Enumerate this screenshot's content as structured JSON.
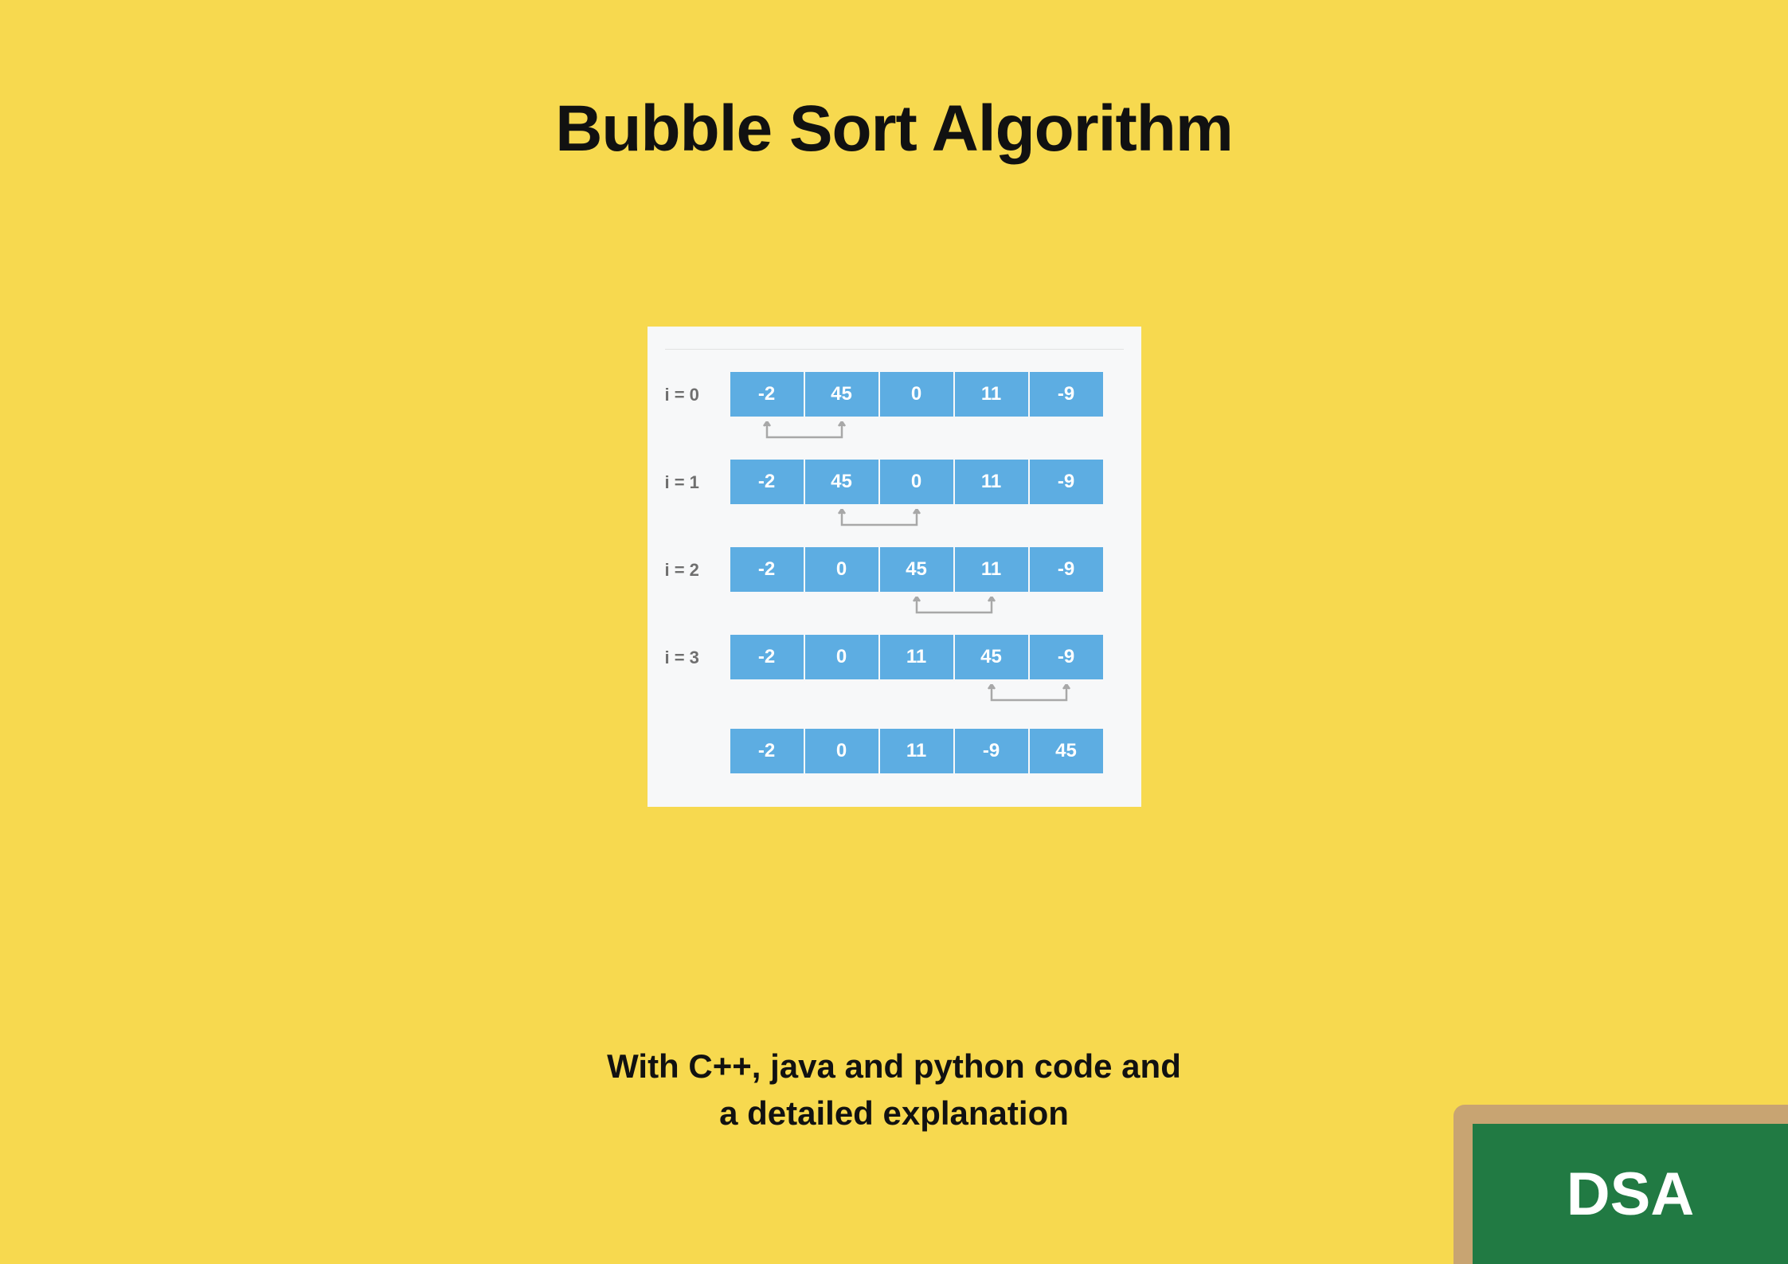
{
  "title": "Bubble Sort Algorithm",
  "subtitle_line1": "With C++, java and python  code and",
  "subtitle_line2": "a detailed explanation",
  "badge": "DSA",
  "colors": {
    "background": "#f7d94f",
    "cell": "#5dade2",
    "boardFrame": "#c8a472",
    "boardGreen": "#217a43"
  },
  "steps": [
    {
      "label": "i = 0",
      "values": [
        "-2",
        "45",
        "0",
        "11",
        "-9"
      ],
      "swap": [
        0,
        1
      ]
    },
    {
      "label": "i = 1",
      "values": [
        "-2",
        "45",
        "0",
        "11",
        "-9"
      ],
      "swap": [
        1,
        2
      ]
    },
    {
      "label": "i = 2",
      "values": [
        "-2",
        "0",
        "45",
        "11",
        "-9"
      ],
      "swap": [
        2,
        3
      ]
    },
    {
      "label": "i = 3",
      "values": [
        "-2",
        "0",
        "11",
        "45",
        "-9"
      ],
      "swap": [
        3,
        4
      ]
    }
  ],
  "final": {
    "values": [
      "-2",
      "0",
      "11",
      "-9",
      "45"
    ]
  }
}
